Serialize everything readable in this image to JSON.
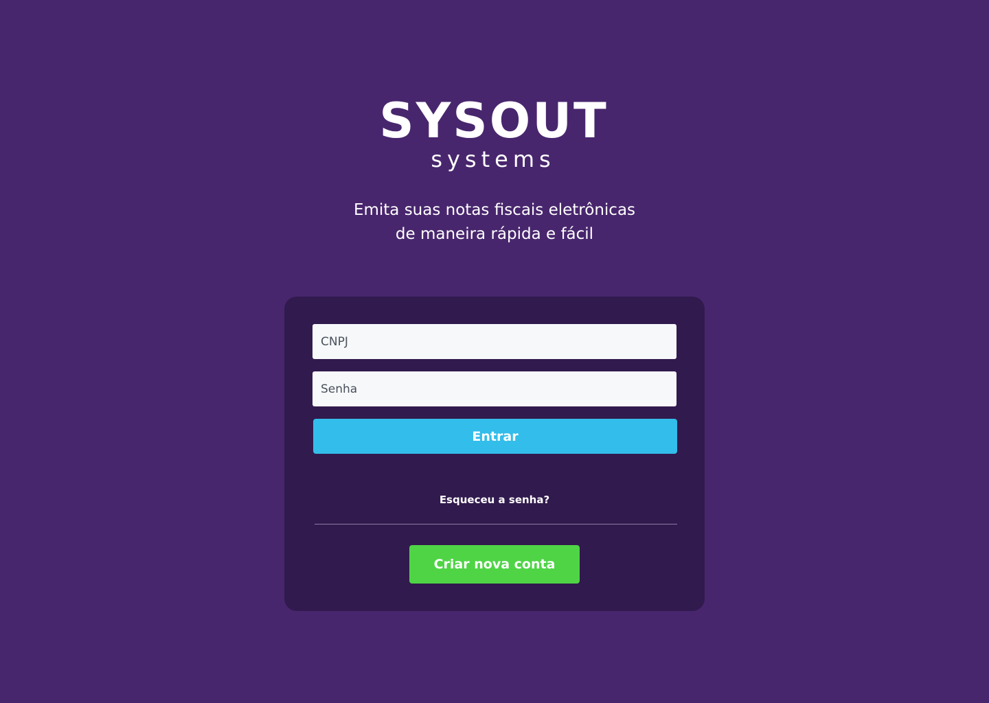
{
  "brand": {
    "name": "SYSOUT",
    "subname": "systems"
  },
  "tagline": {
    "line1": "Emita suas notas fiscais eletrônicas",
    "line2": "de maneira rápida e fácil"
  },
  "login": {
    "cnpj_placeholder": "CNPJ",
    "senha_placeholder": "Senha",
    "submit_label": "Entrar",
    "forgot_label": "Esqueceu a senha?",
    "create_account_label": "Criar nova conta"
  },
  "colors": {
    "background": "#48266d",
    "card": "#311a4d",
    "primary_button": "#33bdea",
    "create_button": "#4fd446"
  }
}
